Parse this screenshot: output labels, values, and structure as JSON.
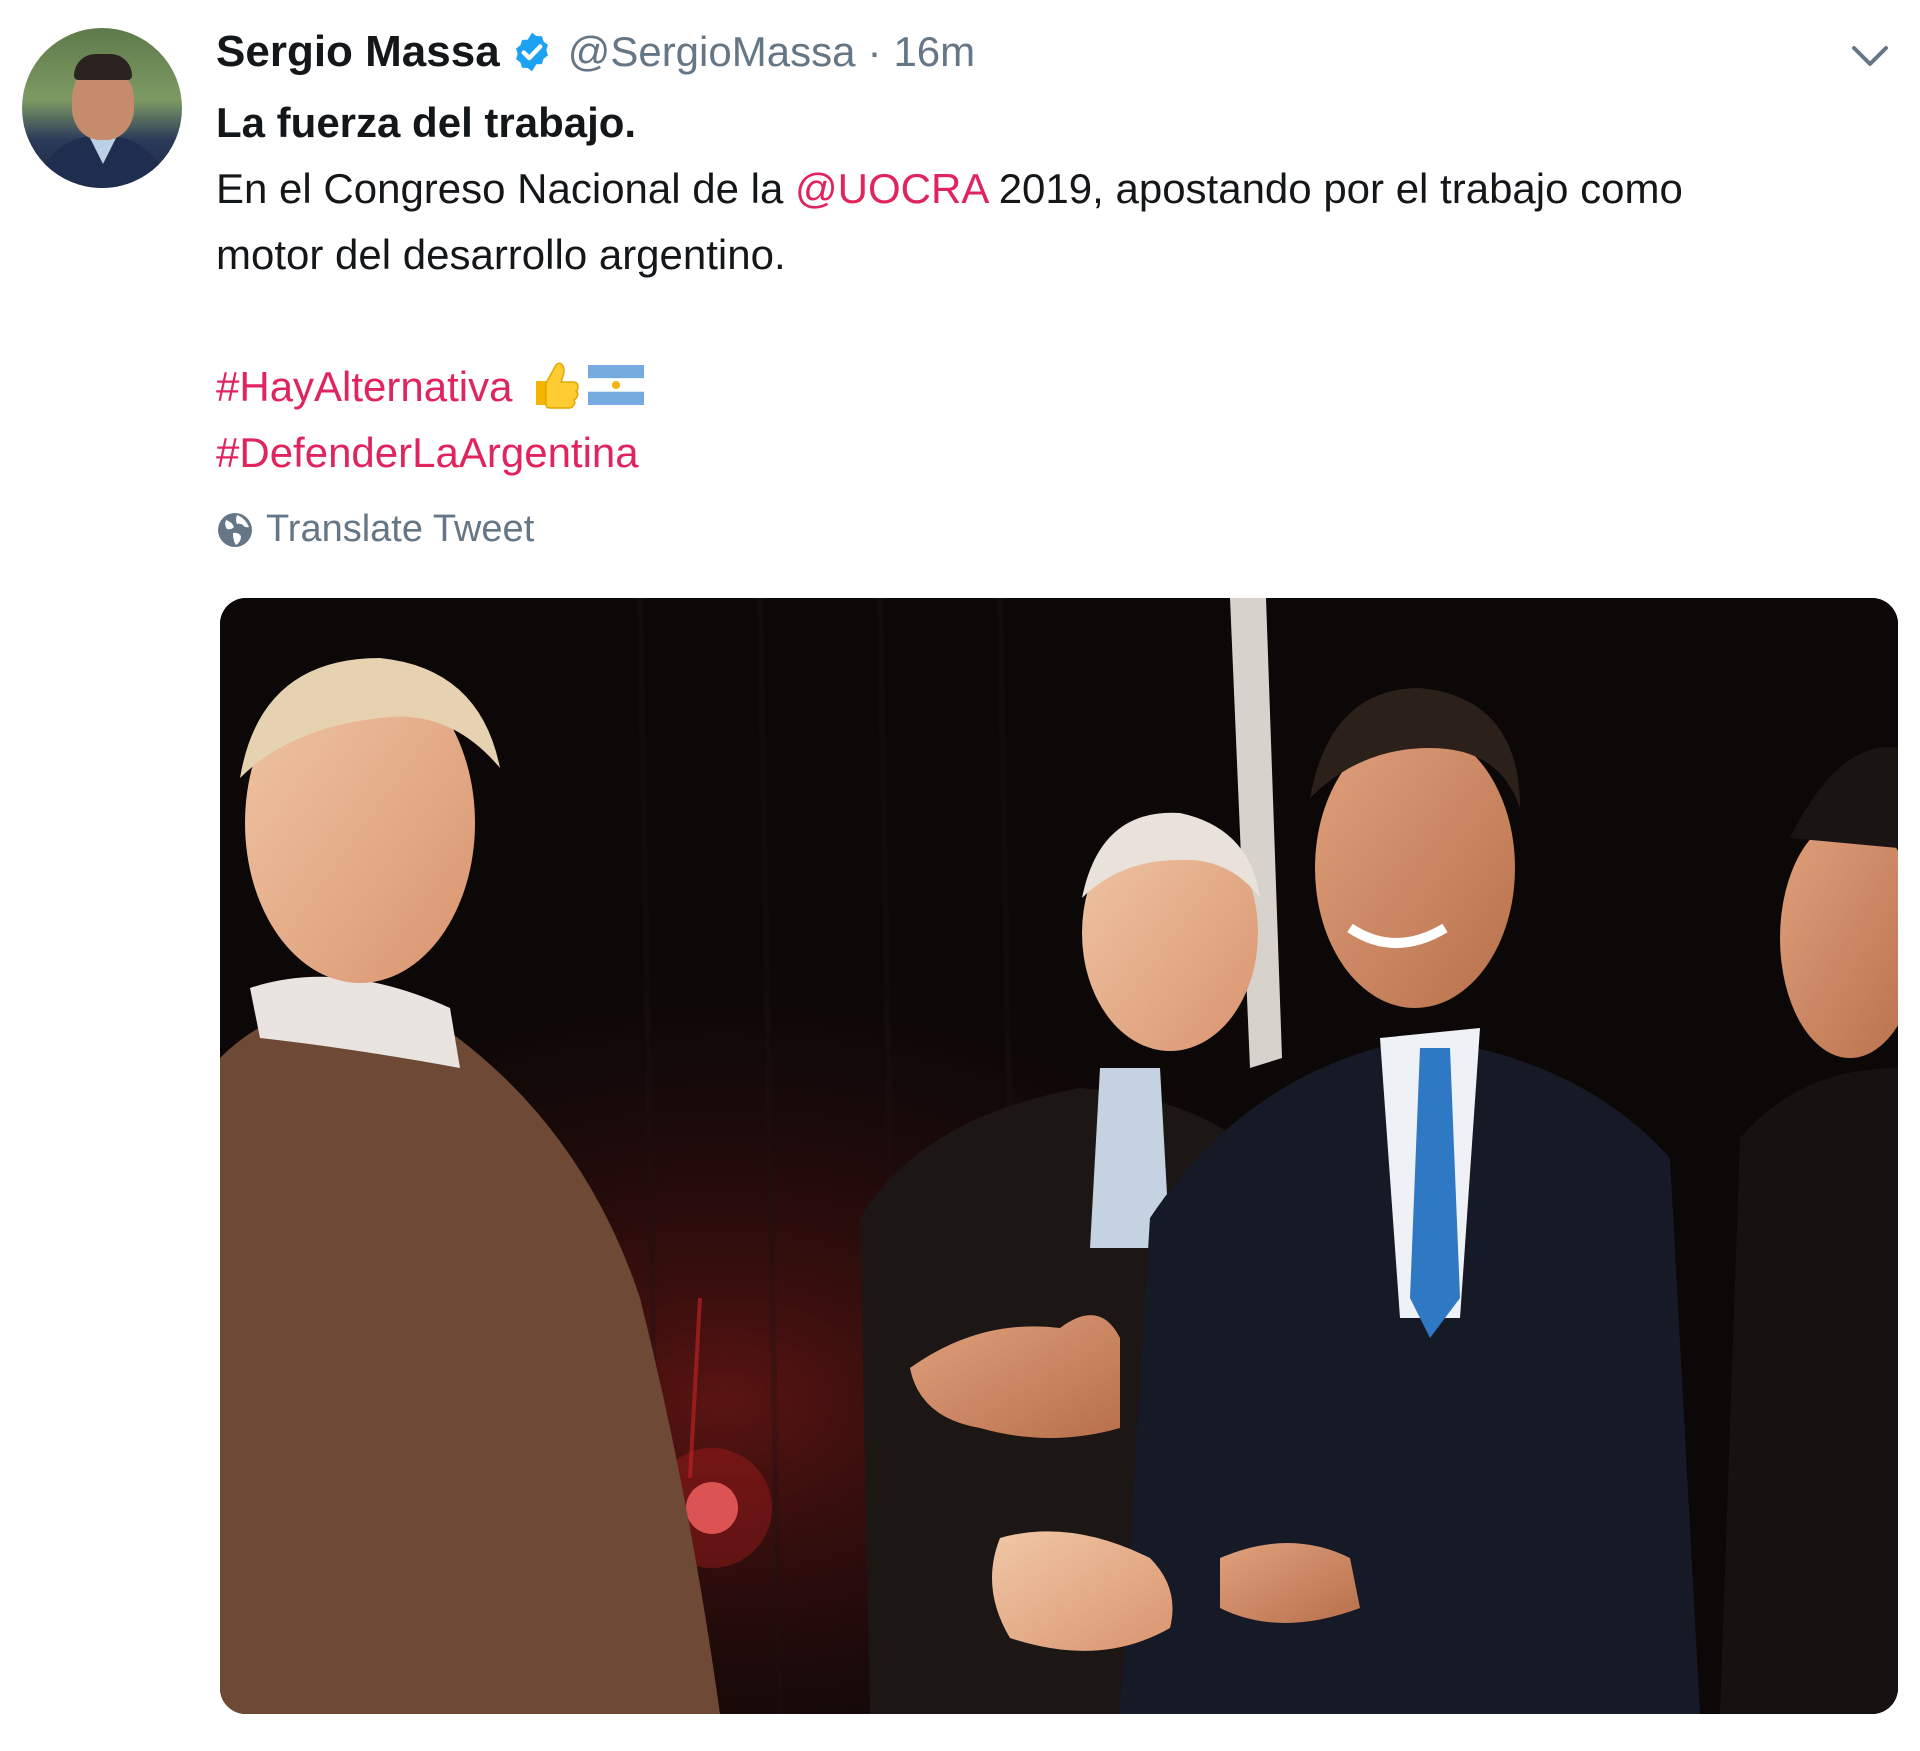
{
  "tweet": {
    "author_name": "Sergio Massa",
    "handle": "@SergioMassa",
    "separator": "·",
    "time": "16m",
    "line1": "La fuerza del trabajo.",
    "line2_pre": "En el Congreso Nacional de la ",
    "mention": "@UOCRA",
    "line2_post": " 2019, apostando por el trabajo como",
    "line3": "motor del desarrollo argentino.",
    "hashtag1": "#HayAlternativa",
    "hashtag2": "#DefenderLaArgentina",
    "translate_label": "Translate Tweet"
  },
  "icons": {
    "verified": "verified-badge-icon",
    "menu": "chevron-down-icon",
    "translate": "globe-icon",
    "emoji1": "thumbs-up-emoji",
    "emoji2": "argentina-flag-emoji"
  },
  "colors": {
    "link": "#e0245e",
    "verified": "#1da1f2",
    "secondary_text": "#657786"
  }
}
